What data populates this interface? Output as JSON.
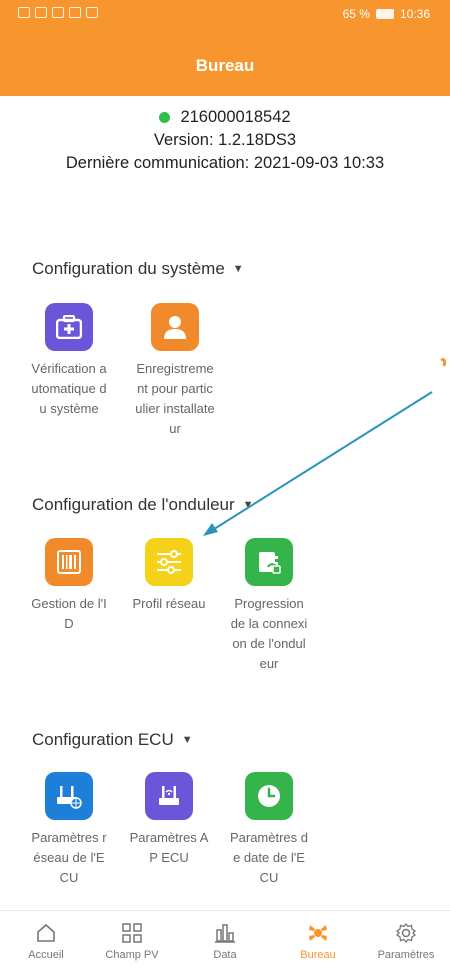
{
  "status_bar": {
    "battery": "65 %",
    "time": "10:36"
  },
  "header": {
    "title": "Bureau"
  },
  "device": {
    "serial": "216000018542",
    "version": "Version: 1.2.18DS3",
    "last_communication": "Dernière communication: 2021-09-03 10:33"
  },
  "sections": {
    "system": {
      "title": "Configuration du système",
      "tiles": [
        {
          "label": "Vérification automatique du système",
          "icon": "medical-kit-icon",
          "color": "#6b55d8"
        },
        {
          "label": "Enregistrement pour particulier installateur",
          "icon": "user-icon",
          "color": "#f08a2b"
        }
      ]
    },
    "inverter": {
      "title": "Configuration de l'onduleur",
      "tiles": [
        {
          "label": "Gestion de l'ID",
          "icon": "barcode-icon",
          "color": "#f08a2b"
        },
        {
          "label": "Profil réseau",
          "icon": "sliders-icon",
          "color": "#f5d11a"
        },
        {
          "label": "Progression de la connexion de l'onduleur",
          "icon": "inverter-connection-icon",
          "color": "#34b44a"
        }
      ]
    },
    "ecu": {
      "title": "Configuration ECU",
      "tiles": [
        {
          "label": "Paramètres réseau de l'ECU",
          "icon": "ecu-network-icon",
          "color": "#1e7fd8"
        },
        {
          "label": "Paramètres AP ECU",
          "icon": "ecu-ap-icon",
          "color": "#6b55d8"
        },
        {
          "label": "Paramètres de date de l'ECU",
          "icon": "clock-icon",
          "color": "#34b44a"
        }
      ]
    }
  },
  "bottom_nav": [
    {
      "label": "Accueil",
      "icon": "home-icon"
    },
    {
      "label": "Champ PV",
      "icon": "grid-icon"
    },
    {
      "label": "Data",
      "icon": "bar-chart-icon"
    },
    {
      "label": "Bureau",
      "icon": "bureau-icon",
      "active": true
    },
    {
      "label": "Paramètres",
      "icon": "settings-gear-icon"
    }
  ],
  "colors": {
    "accent": "#f7962e",
    "online": "#2fbf4a",
    "arrow": "#2a94b8"
  }
}
